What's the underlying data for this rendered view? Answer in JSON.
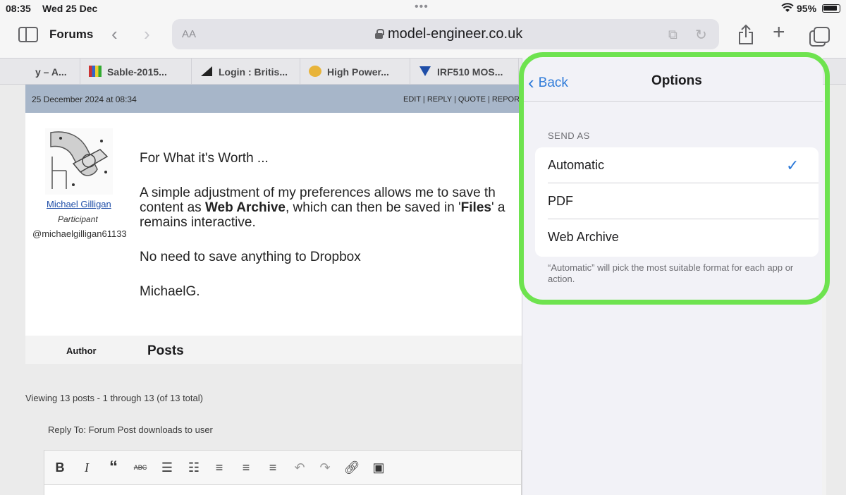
{
  "status": {
    "time": "08:35",
    "date": "Wed 25 Dec",
    "battery": "95%"
  },
  "toolbar": {
    "title": "Forums",
    "text_size": "AA",
    "domain": "model-engineer.co.uk"
  },
  "tabs": [
    {
      "label": "y – A..."
    },
    {
      "label": "Sable-2015..."
    },
    {
      "label": "Login : Britis..."
    },
    {
      "label": "High Power..."
    },
    {
      "label": "IRF510 MOS..."
    }
  ],
  "post": {
    "date": "25 December 2024 at 08:34",
    "actions": "EDIT | REPLY | QUOTE | REPORT",
    "author_name": "Michael Gilligan",
    "author_role": "Participant",
    "author_handle": "@michaelgilligan61133",
    "line1": "For What it's Worth ...",
    "p2_a": "A simple adjustment of my preferences allows me to save th",
    "p2_b": "content as ",
    "p2_bold1": "Web Archive",
    "p2_c": ", which can then be saved in '",
    "p2_bold2": "Files",
    "p2_d": "' a",
    "p2_e": "remains interactive.",
    "line3": "No need to save anything to Dropbox",
    "sign": "MichaelG."
  },
  "table_head": {
    "author": "Author",
    "posts": "Posts"
  },
  "viewing": "Viewing 13 posts - 1 through 13 (of 13 total)",
  "reply_to": "Reply To: Forum Post downloads to user",
  "options": {
    "back": "Back",
    "title": "Options",
    "section": "SEND AS",
    "items": [
      {
        "label": "Automatic",
        "selected": true
      },
      {
        "label": "PDF",
        "selected": false
      },
      {
        "label": "Web Archive",
        "selected": false
      }
    ],
    "footnote": "“Automatic” will pick the most suitable format for each app or action."
  },
  "colors": {
    "accent": "#2f7bd9",
    "highlight": "#6ee34f",
    "post_bar": "#a7b6c9"
  }
}
